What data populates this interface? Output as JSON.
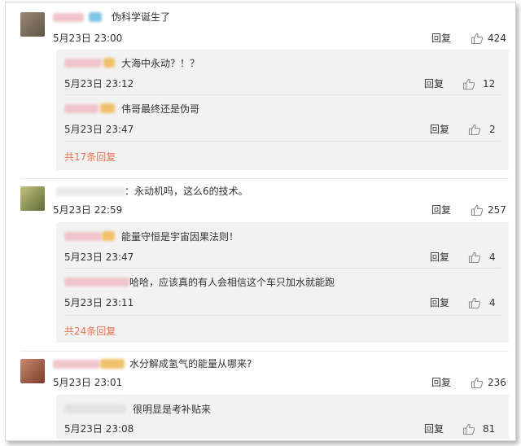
{
  "comments": [
    {
      "text": "伪科学诞生了",
      "date": "5月23日 23:00",
      "reply_label": "回复",
      "likes": "424",
      "replies": [
        {
          "text": "大海中永动？！？",
          "date": "5月23日 23:12",
          "reply_label": "回复",
          "likes": "12"
        },
        {
          "text": "伟哥最终还是伪哥",
          "date": "5月23日 23:47",
          "reply_label": "回复",
          "likes": "2"
        }
      ],
      "more_replies": "共17条回复"
    },
    {
      "text": "：永动机吗，这么6的技术。",
      "date": "5月23日 22:59",
      "reply_label": "回复",
      "likes": "257",
      "replies": [
        {
          "text": "能量守恒是宇宙因果法则！",
          "date": "5月23日 23:47",
          "reply_label": "回复",
          "likes": "4"
        },
        {
          "text": "哈哈，应该真的有人会相信这个车只加水就能跑",
          "date": "5月23日 23:11",
          "reply_label": "回复",
          "likes": "4"
        }
      ],
      "more_replies": "共24条回复"
    },
    {
      "text": "水分解成氢气的能量从哪来?",
      "date": "5月23日 23:01",
      "reply_label": "回复",
      "likes": "236",
      "replies": [
        {
          "text": "很明显是考补贴来",
          "date": "5月23日 23:08",
          "reply_label": "回复",
          "likes": "81"
        }
      ]
    }
  ],
  "colors": {
    "more_link": "#eb7350",
    "sub_bg": "#f2f2f2",
    "text": "#333333"
  },
  "icons": {
    "like": "thumbs-up-icon"
  }
}
